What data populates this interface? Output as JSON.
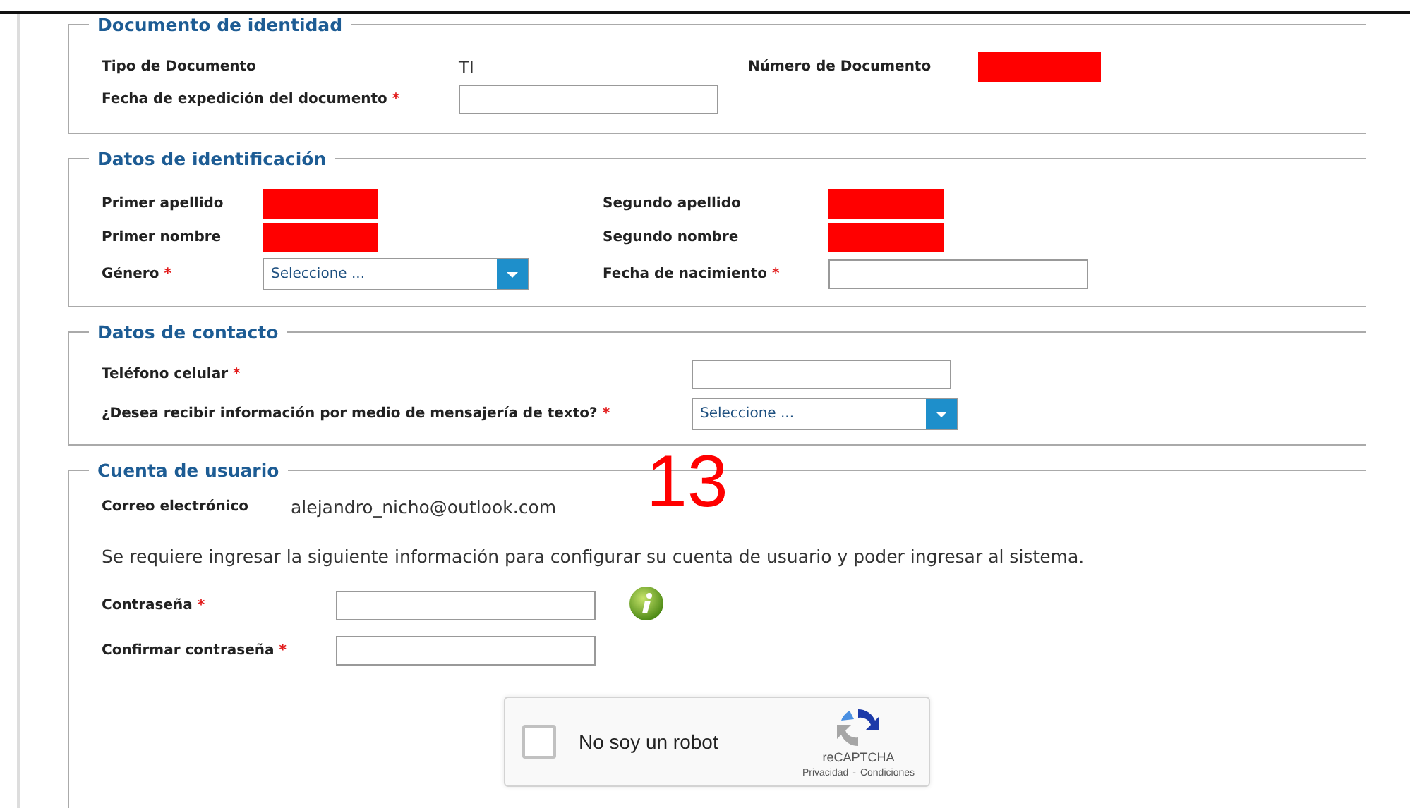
{
  "sections": [
    {
      "legend": "Documento de identidad",
      "fields": [
        {
          "kind": "text",
          "label": "Tipo de Documento",
          "value": "TI"
        },
        {
          "kind": "redacted",
          "label": "Número de Documento"
        },
        {
          "kind": "input",
          "label": "Fecha de expedición del documento",
          "marker": "*"
        }
      ]
    },
    {
      "legend": "Datos de identificación",
      "fields": [
        {
          "kind": "redacted",
          "label": "Primer apellido"
        },
        {
          "kind": "redacted",
          "label": "Segundo apellido"
        },
        {
          "kind": "redacted",
          "label": "Primer nombre"
        },
        {
          "kind": "redacted",
          "label": "Segundo nombre"
        },
        {
          "kind": "select",
          "label": "Género",
          "marker": "*",
          "value": "Seleccione ..."
        },
        {
          "kind": "input",
          "label": "Fecha de nacimiento",
          "marker": "*"
        }
      ]
    },
    {
      "legend": "Datos de contacto",
      "fields": [
        {
          "kind": "input",
          "label": "Teléfono celular",
          "marker": "*"
        },
        {
          "kind": "select",
          "label": "¿Desea recibir información por medio de mensajería de texto?",
          "marker": "*",
          "value": "Seleccione ..."
        }
      ]
    },
    {
      "legend": "Cuenta de usuario",
      "fields": [
        {
          "kind": "text",
          "label": "Correo electrónico",
          "value": "alejandro_nicho@outlook.com"
        },
        {
          "kind": "note",
          "text": "Se requiere ingresar la siguiente información para configurar su cuenta de usuario y poder ingresar al sistema."
        },
        {
          "kind": "password",
          "label": "Contraseña",
          "marker": "*",
          "info": true
        },
        {
          "kind": "password",
          "label": "Confirmar contraseña",
          "marker": "*",
          "info": false
        },
        {
          "kind": "captcha",
          "label": "No soy un robot",
          "checked": false,
          "brand": "reCAPTCHA",
          "links": [
            "Privacidad",
            "Condiciones"
          ],
          "separator": "-"
        }
      ]
    }
  ],
  "annotation": "13"
}
